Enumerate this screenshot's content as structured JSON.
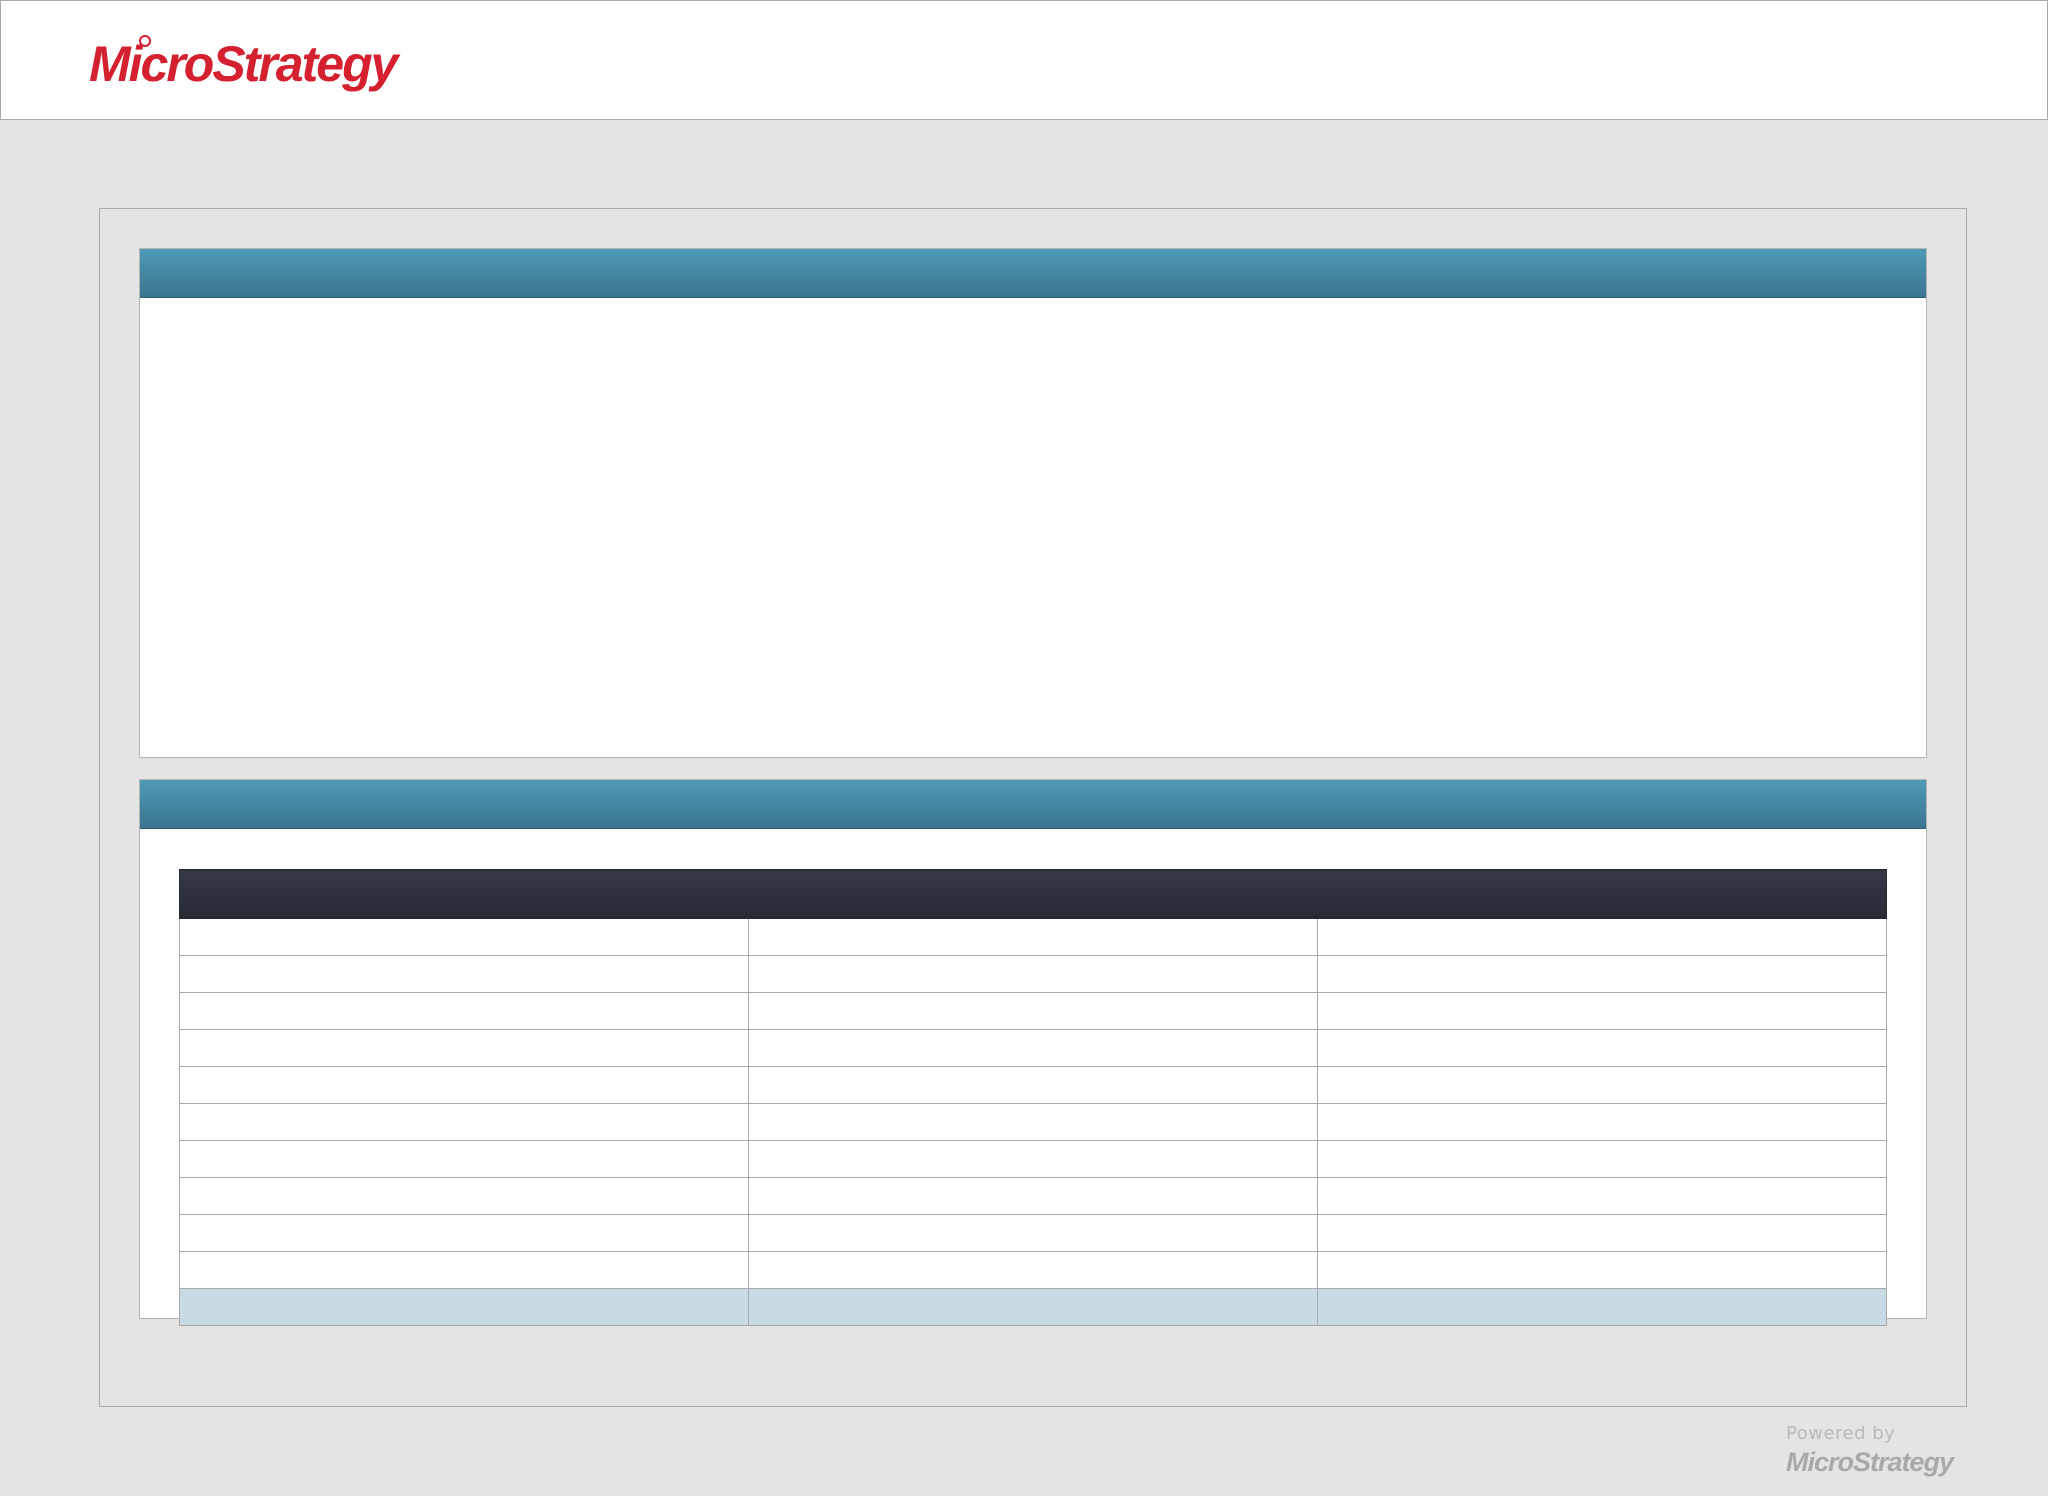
{
  "brand": {
    "name": "MicroStrategy",
    "color": "#d4202f"
  },
  "footer": {
    "powered_by": "Powered by",
    "brand": "MicroStrategy"
  },
  "colors": {
    "page_background": "#e4e4e4",
    "section_header": "#4a8fab",
    "table_header": "#2b2f3b",
    "total_row": "#c8dbe4"
  },
  "sections": [
    {
      "title": ""
    },
    {
      "title": ""
    }
  ],
  "grid": {
    "columns": [
      "",
      "",
      ""
    ],
    "rows": [
      [
        "",
        "",
        ""
      ],
      [
        "",
        "",
        ""
      ],
      [
        "",
        "",
        ""
      ],
      [
        "",
        "",
        ""
      ],
      [
        "",
        "",
        ""
      ],
      [
        "",
        "",
        ""
      ],
      [
        "",
        "",
        ""
      ],
      [
        "",
        "",
        ""
      ],
      [
        "",
        "",
        ""
      ],
      [
        "",
        "",
        ""
      ]
    ],
    "total": [
      "",
      "",
      ""
    ]
  }
}
